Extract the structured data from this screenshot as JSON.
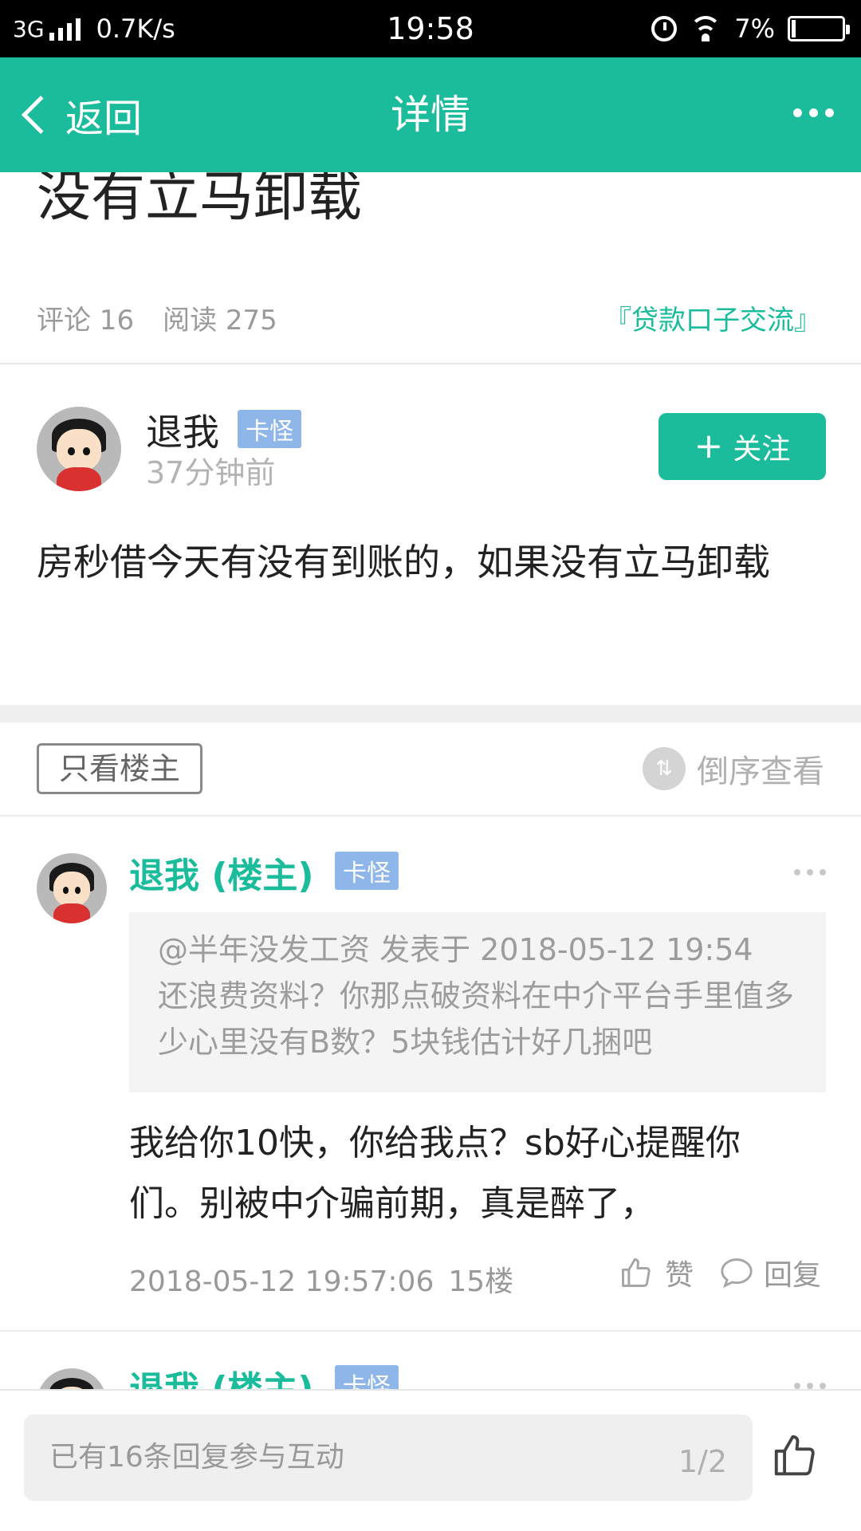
{
  "status_bar": {
    "network": "3G",
    "speed": "0.7K/s",
    "time": "19:58",
    "battery": "7%"
  },
  "nav": {
    "back_label": "返回",
    "title": "详情"
  },
  "post": {
    "title": "房秒借今天有没有到账的，如果没有立马卸载",
    "comments_label": "评论 16",
    "reads_label": "阅读 275",
    "category": "『贷款口子交流』",
    "author": {
      "name": "退我",
      "badge": "卡怪",
      "time": "37分钟前"
    },
    "follow_label": "关注",
    "body": "房秒借今天有没有到账的，如果没有立马卸载"
  },
  "filters": {
    "only_owner": "只看楼主",
    "reverse": "倒序查看"
  },
  "replies": [
    {
      "name": "退我 (楼主)",
      "badge": "卡怪",
      "quote_header": "@半年没发工资 发表于 2018-05-12 19:54",
      "quote_body": "还浪费资料？你那点破资料在中介平台手里值多少心里没有B数？5块钱估计好几捆吧",
      "body": "我给你10快，你给我点？sb好心提醒你们。别被中介骗前期，真是醉了，",
      "date": "2018-05-12 19:57:06",
      "floor": "15楼",
      "like_label": "赞",
      "reply_label": "回复"
    },
    {
      "name": "退我 (楼主)",
      "badge": "卡怪"
    }
  ],
  "bottom": {
    "placeholder": "已有16条回复参与互动",
    "page": "1/2"
  },
  "colors": {
    "accent": "#1ABC9C",
    "badge": "#8FB6E8",
    "status_bar": "#000000"
  }
}
